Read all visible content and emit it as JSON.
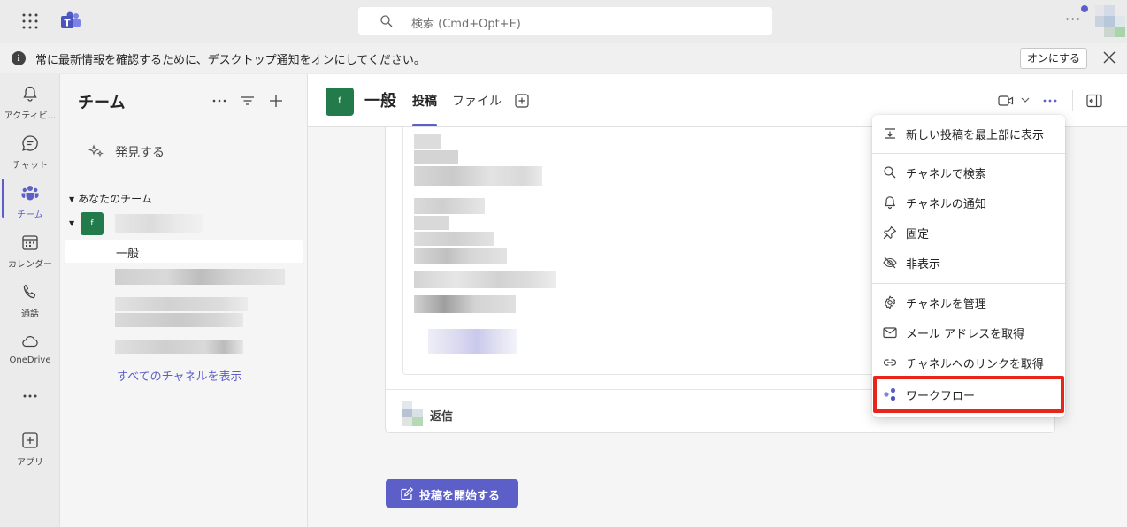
{
  "topbar": {
    "search_placeholder": "検索 (Cmd+Opt+E)"
  },
  "banner": {
    "message": "常に最新情報を確認するために、デスクトップ通知をオンにしてください。",
    "button_label": "オンにする",
    "info_icon": "i"
  },
  "rail": {
    "items": [
      {
        "label": "アクティビ...",
        "icon": "bell-icon"
      },
      {
        "label": "チャット",
        "icon": "chat-icon"
      },
      {
        "label": "チーム",
        "icon": "teams-icon"
      },
      {
        "label": "カレンダー",
        "icon": "calendar-icon"
      },
      {
        "label": "通話",
        "icon": "phone-icon"
      },
      {
        "label": "OneDrive",
        "icon": "cloud-icon"
      },
      {
        "label": "アプリ",
        "icon": "add-apps-icon"
      }
    ],
    "active_color": "#5b5fc7"
  },
  "panel": {
    "title": "チーム",
    "discover_label": "発見する",
    "section_header": "あなたのチーム",
    "team_initial": "f",
    "active_channel": "一般",
    "all_channels_link": "すべてのチャネルを表示"
  },
  "channel": {
    "initial": "f",
    "name": "一般",
    "tabs": [
      "投稿",
      "ファイル"
    ],
    "reply_label": "返信",
    "new_post_label": "投稿を開始する"
  },
  "menu": {
    "items": [
      {
        "label": "新しい投稿を最上部に表示",
        "icon": "sort-top-icon"
      },
      {
        "label": "チャネルで検索",
        "icon": "search-icon"
      },
      {
        "label": "チャネルの通知",
        "icon": "bell-icon"
      },
      {
        "label": "固定",
        "icon": "pin-icon"
      },
      {
        "label": "非表示",
        "icon": "eye-off-icon"
      },
      {
        "label": "チャネルを管理",
        "icon": "gear-icon"
      },
      {
        "label": "メール アドレスを取得",
        "icon": "mail-icon"
      },
      {
        "label": "チャネルへのリンクを取得",
        "icon": "link-icon"
      },
      {
        "label": "ワークフロー",
        "icon": "workflow-icon"
      }
    ]
  },
  "colors": {
    "brand": "#5b5fc7",
    "team_avatar": "#237b4b",
    "highlight": "#e8251b"
  }
}
